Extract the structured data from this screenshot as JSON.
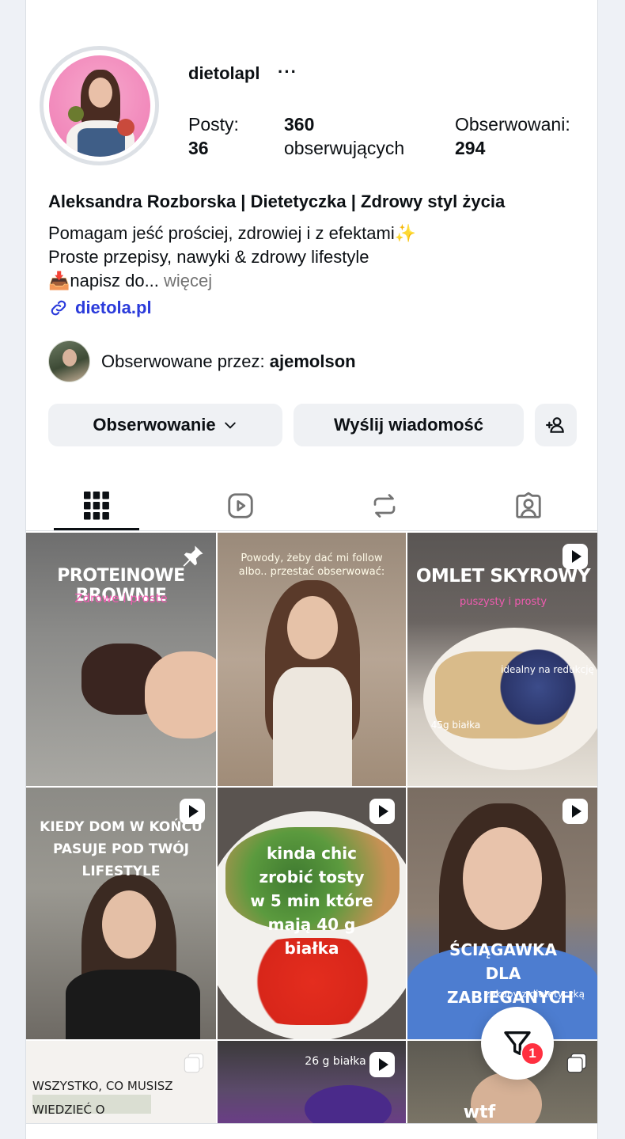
{
  "profile": {
    "username": "dietolapl",
    "more_label": "···",
    "posts_label": "Posty:",
    "posts_count": "36",
    "followers_count": "360",
    "followers_label": "obserwujących",
    "following_label": "Obserwowani:",
    "following_count": "294",
    "full_name": "Aleksandra Rozborska | Dietetyczka | Zdrowy styl życia",
    "bio_line1": "Pomagam jeść prościej, zdrowiej i z efektami✨",
    "bio_line2": "Proste przepisy, nawyki & zdrowy lifestyle",
    "bio_line3": "📥napisz do...",
    "bio_more": " więcej",
    "link": "dietola.pl",
    "followed_by_label": "Obserwowane przez: ",
    "followed_by_user": "ajemolson"
  },
  "actions": {
    "following_button": "Obserwowanie",
    "message_button": "Wyślij wiadomość"
  },
  "tabs": [
    {
      "name": "posts",
      "icon": "grid-icon",
      "active": true
    },
    {
      "name": "reels",
      "icon": "reels-icon",
      "active": false
    },
    {
      "name": "reposts",
      "icon": "repost-icon",
      "active": false
    },
    {
      "name": "tagged",
      "icon": "tagged-icon",
      "active": false
    }
  ],
  "posts": [
    {
      "title": "PROTEINOWE BROWNIE",
      "subtitle": "Zdrowe i proste",
      "icon": "pin-icon"
    },
    {
      "title": "Powody, żeby dać mi follow albo.. przestać obserwować:",
      "subtitle": "",
      "icon": ""
    },
    {
      "title": "OMLET SKYROWY",
      "subtitle": "puszysty i prosty",
      "extra1": "idealny na redukcję",
      "extra2": "45g białka",
      "icon": "reel-icon"
    },
    {
      "title": "KIEDY DOM W KOŃCU PASUJE POD TWÓJ LIFESTYLE",
      "subtitle": "",
      "icon": "reel-icon"
    },
    {
      "title": "kinda chic zrobić tosty w 5 min które mają 40 g białka",
      "subtitle": "",
      "icon": "reel-icon"
    },
    {
      "title": "ŚCIĄGAWKA DLA ZABIEGANYCH",
      "subtitle": "zakupy z dietetyczką",
      "icon": "reel-icon"
    },
    {
      "title": "WSZYSTKO, CO MUSISZ WIEDZIEĆ O WĘGLOWODANACH",
      "subtitle": "",
      "icon": "carousel-icon"
    },
    {
      "title": "26 g białka",
      "subtitle": "",
      "icon": "reel-icon"
    },
    {
      "title": "wtf",
      "subtitle": "",
      "icon": "carousel-icon"
    }
  ],
  "fab": {
    "badge": "1",
    "icon": "filter-icon"
  },
  "colors": {
    "link": "#2b3bdb",
    "badge": "#ff3040",
    "button_bg": "#eff1f4"
  }
}
